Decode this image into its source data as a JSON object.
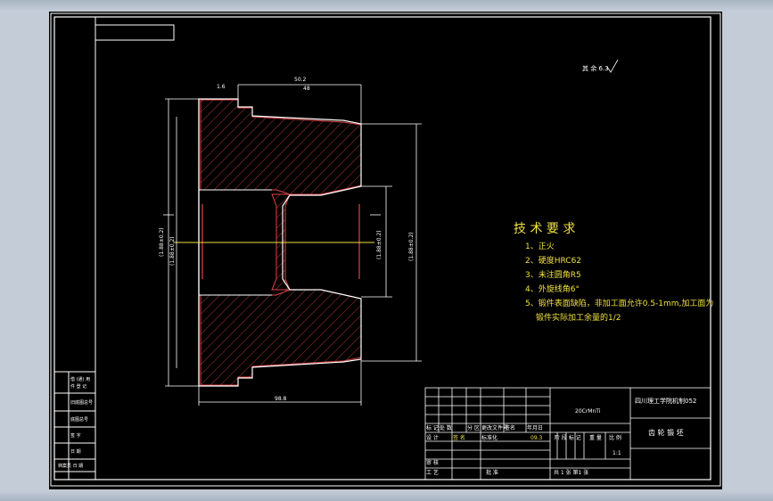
{
  "drawing": {
    "tech_requirements": {
      "title": "技 术 要 求",
      "items": [
        "1、正火",
        "2、硬度HRC62",
        "3、未注圆角R5",
        "4、外旋线角6°",
        "5、锻件表面缺陷，非加工面允许0.5-1mm,加工面为",
        "锻件实际加工余量的1/2"
      ]
    },
    "roughness_note": "其 余 6.3",
    "dimensions": {
      "top_left": "1.6",
      "top_mid": "50.2",
      "top_mid2": "48",
      "left_outer": "(1.88±0.2)",
      "left_inner": "(1.88±0.2)",
      "right_outer": "(1.88±0.2)",
      "right_inner": "(1.88±0.2)",
      "bottom": "98.8"
    },
    "title_block": {
      "company": "四川理工学院机制052",
      "part_name": "齿 轮 锻 坯",
      "material": "20CrMnTi",
      "scale": "1:1",
      "headers": [
        "标 记",
        "处 数",
        "分 区",
        "更改文件号",
        "签名",
        "年月日"
      ],
      "row_design": [
        "设 计",
        "签 名",
        "标准化"
      ],
      "row_check": [
        "审 核"
      ],
      "row_process": [
        "工 艺"
      ],
      "approve": "批 准",
      "stage_headers": [
        "阶 段 标 记",
        "重 量",
        "比 例"
      ],
      "sheet_info": "共 1 张  第1 张",
      "date": "09.3"
    },
    "left_column": [
      "借 (通) 用",
      "件 登 记",
      "旧底图总号",
      "底图总号",
      "签 字",
      "日 期",
      "档案员 日 期"
    ]
  }
}
